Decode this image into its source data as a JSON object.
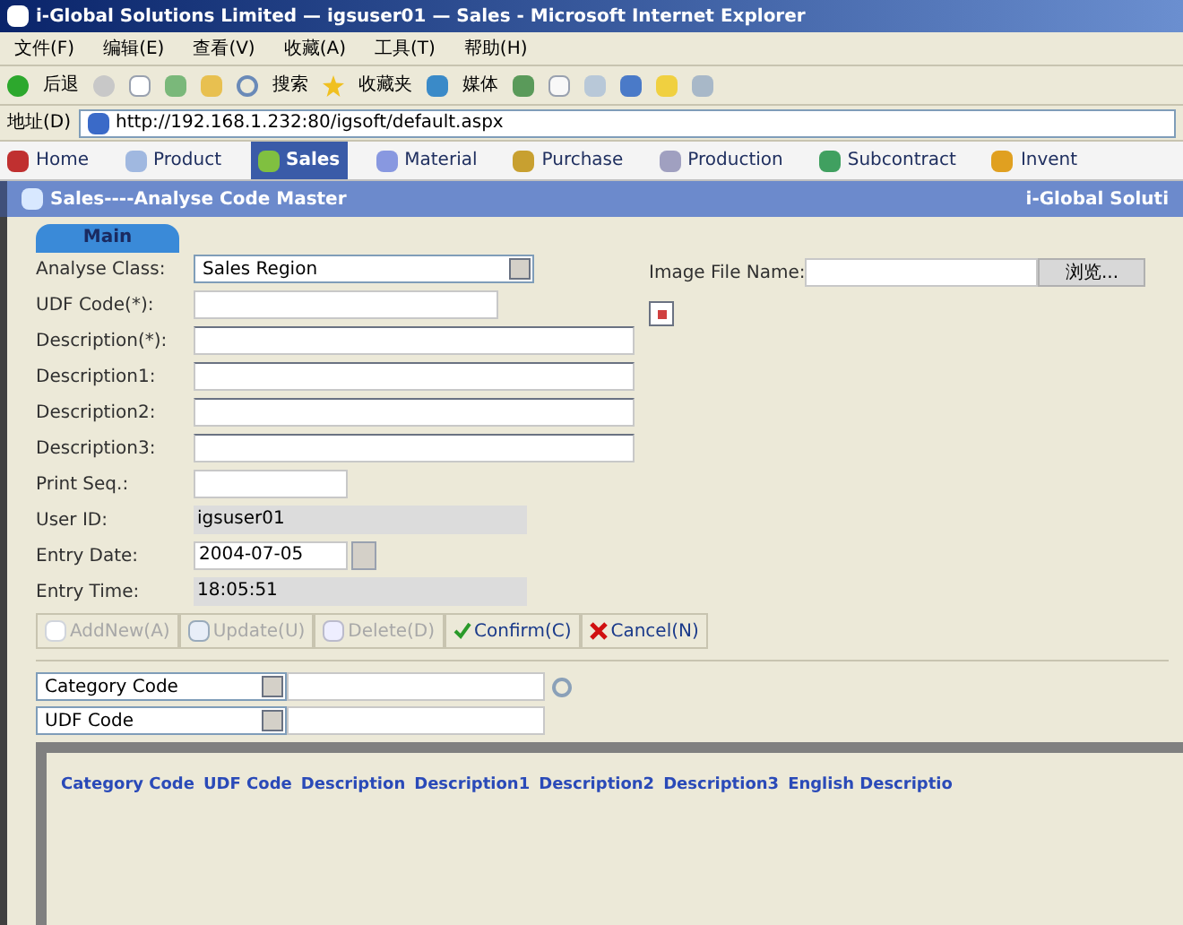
{
  "window": {
    "title": "i-Global Solutions Limited — igsuser01 — Sales - Microsoft Internet Explorer"
  },
  "menu": [
    "文件(F)",
    "编辑(E)",
    "查看(V)",
    "收藏(A)",
    "工具(T)",
    "帮助(H)"
  ],
  "toolbar": {
    "back": "后退",
    "search": "搜索",
    "favorites": "收藏夹",
    "media": "媒体"
  },
  "address": {
    "label": "地址(D)",
    "value": "http://192.168.1.232:80/igsoft/default.aspx"
  },
  "nav_tabs": [
    {
      "label": "Home",
      "selected": false
    },
    {
      "label": "Product",
      "selected": false
    },
    {
      "label": "Sales",
      "selected": true
    },
    {
      "label": "Material",
      "selected": false
    },
    {
      "label": "Purchase",
      "selected": false
    },
    {
      "label": "Production",
      "selected": false
    },
    {
      "label": "Subcontract",
      "selected": false
    },
    {
      "label": "Invent",
      "selected": false
    }
  ],
  "page_header": {
    "title": "Sales----Analyse Code Master",
    "company": "i-Global Soluti"
  },
  "form_tab": {
    "label": "Main",
    "selected": true
  },
  "fields": [
    {
      "label": "Analyse Class:",
      "kind": "select",
      "value": "Sales Region"
    },
    {
      "label": "UDF Code(*):",
      "kind": "input"
    },
    {
      "label": "Description(*):",
      "kind": "wide"
    },
    {
      "label": "Description1:",
      "kind": "wide"
    },
    {
      "label": "Description2:",
      "kind": "wide"
    },
    {
      "label": "Description3:",
      "kind": "wide"
    },
    {
      "label": "Print Seq.:",
      "kind": "short"
    },
    {
      "label": "User ID:",
      "kind": "readonly",
      "value": "igsuser01"
    },
    {
      "label": "Entry Date:",
      "kind": "date",
      "value": "2004-07-05"
    },
    {
      "label": "Entry Time:",
      "kind": "readonly",
      "value": "18:05:51"
    }
  ],
  "image_field": {
    "label": "Image File Name:",
    "browse": "浏览..."
  },
  "actions": [
    {
      "label": "AddNew(A)",
      "kind": "add",
      "disabled": true
    },
    {
      "label": "Update(U)",
      "kind": "update",
      "disabled": true
    },
    {
      "label": "Delete(D)",
      "kind": "delete",
      "disabled": true
    },
    {
      "label": "Confirm(C)",
      "kind": "confirm",
      "disabled": false
    },
    {
      "label": "Cancel(N)",
      "kind": "cancel",
      "disabled": false
    }
  ],
  "search_rows": [
    {
      "field": "Category Code"
    },
    {
      "field": "UDF Code"
    }
  ],
  "table": {
    "columns": [
      "Category Code",
      "UDF Code",
      "Description",
      "Description1",
      "Description2",
      "Description3",
      "English Descriptio"
    ]
  }
}
